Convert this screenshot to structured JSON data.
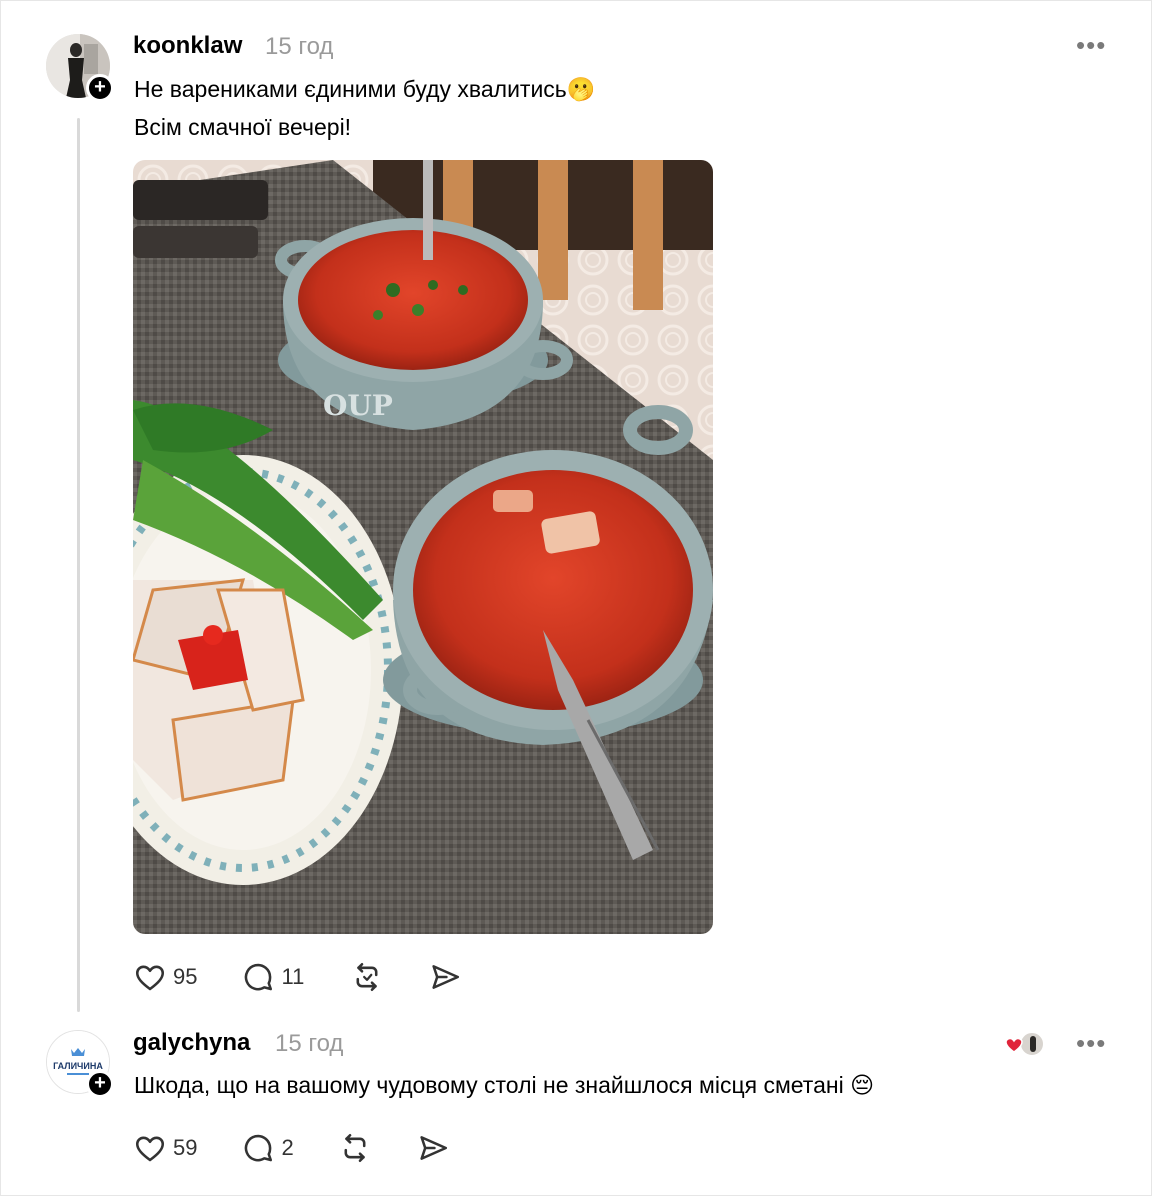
{
  "post1": {
    "username": "koonklaw",
    "time": "15 год",
    "more_icon": "more-dots-icon",
    "text_line1": "Не варениками єдиними буду хвалитись🫢",
    "text_line2": "Всім смачної вечері!",
    "likes": "95",
    "replies": "11"
  },
  "post2": {
    "username": "galychyna",
    "avatar_text": "ГАЛИЧИНА",
    "time": "15 год",
    "text": "Шкода, що на вашому чудовому столі не знайшлося місця сметані 😔",
    "likes": "59",
    "replies": "2"
  },
  "icons": [
    "heart-icon",
    "comment-icon",
    "repost-icon",
    "share-icon",
    "plus-icon"
  ],
  "colors": {
    "text": "#000000",
    "muted": "#9a9a9a",
    "thread_line": "#d9d9d9",
    "borscht": "#c8321c",
    "bowl": "#8fa5a6",
    "heart_red": "#e0243a"
  }
}
